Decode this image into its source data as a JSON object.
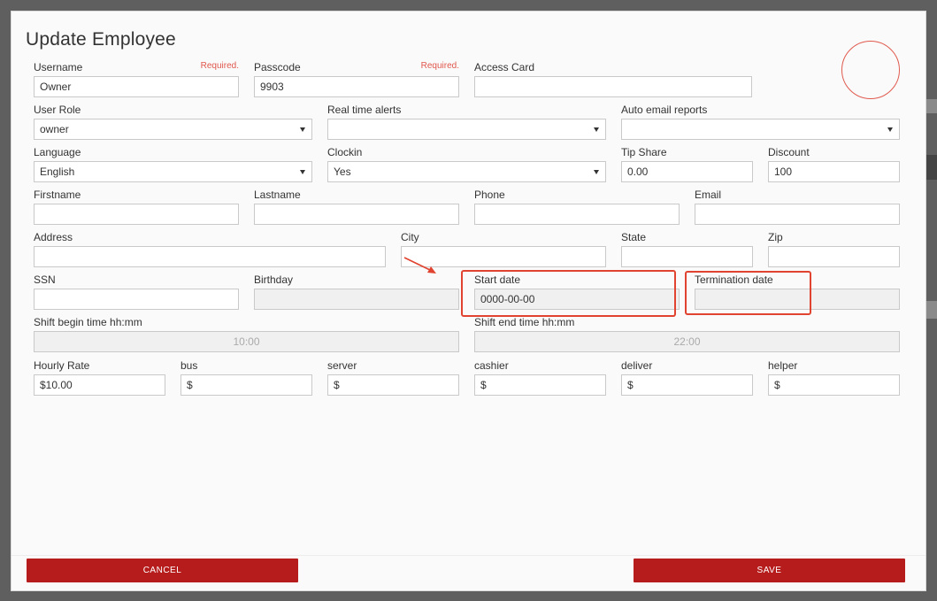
{
  "dialog": {
    "title": "Update Employee"
  },
  "colors": {
    "primary_button": "#b71c1c",
    "required": "#e0574c",
    "highlight": "#e0432f"
  },
  "fields": {
    "username": {
      "label": "Username",
      "required": "Required.",
      "value": "Owner"
    },
    "passcode": {
      "label": "Passcode",
      "required": "Required.",
      "value": "9903"
    },
    "access_card": {
      "label": "Access Card",
      "value": ""
    },
    "user_role": {
      "label": "User Role",
      "value": "owner"
    },
    "real_time_alerts": {
      "label": "Real time alerts",
      "value": ""
    },
    "auto_email_reports": {
      "label": "Auto email reports",
      "value": ""
    },
    "language": {
      "label": "Language",
      "value": "English"
    },
    "clockin": {
      "label": "Clockin",
      "value": "Yes"
    },
    "tip_share": {
      "label": "Tip Share",
      "value": "0.00"
    },
    "discount": {
      "label": "Discount",
      "value": "100"
    },
    "firstname": {
      "label": "Firstname",
      "value": ""
    },
    "lastname": {
      "label": "Lastname",
      "value": ""
    },
    "phone": {
      "label": "Phone",
      "value": ""
    },
    "email": {
      "label": "Email",
      "value": ""
    },
    "address": {
      "label": "Address",
      "value": ""
    },
    "city": {
      "label": "City",
      "value": ""
    },
    "state": {
      "label": "State",
      "value": ""
    },
    "zip": {
      "label": "Zip",
      "value": ""
    },
    "ssn": {
      "label": "SSN",
      "value": ""
    },
    "birthday": {
      "label": "Birthday",
      "value": ""
    },
    "start_date": {
      "label": "Start date",
      "value": "0000-00-00"
    },
    "termination_date": {
      "label": "Termination date",
      "value": ""
    },
    "shift_begin": {
      "label": "Shift begin time hh:mm",
      "value": "10:00"
    },
    "shift_end": {
      "label": "Shift end time hh:mm",
      "value": "22:00"
    },
    "hourly_rate": {
      "label": "Hourly Rate",
      "value": "$10.00"
    },
    "bus": {
      "label": "bus",
      "value": "$"
    },
    "server": {
      "label": "server",
      "value": "$"
    },
    "cashier": {
      "label": "cashier",
      "value": "$"
    },
    "deliver": {
      "label": "deliver",
      "value": "$"
    },
    "helper": {
      "label": "helper",
      "value": "$"
    }
  },
  "buttons": {
    "cancel": "CANCEL",
    "save": "SAVE"
  }
}
